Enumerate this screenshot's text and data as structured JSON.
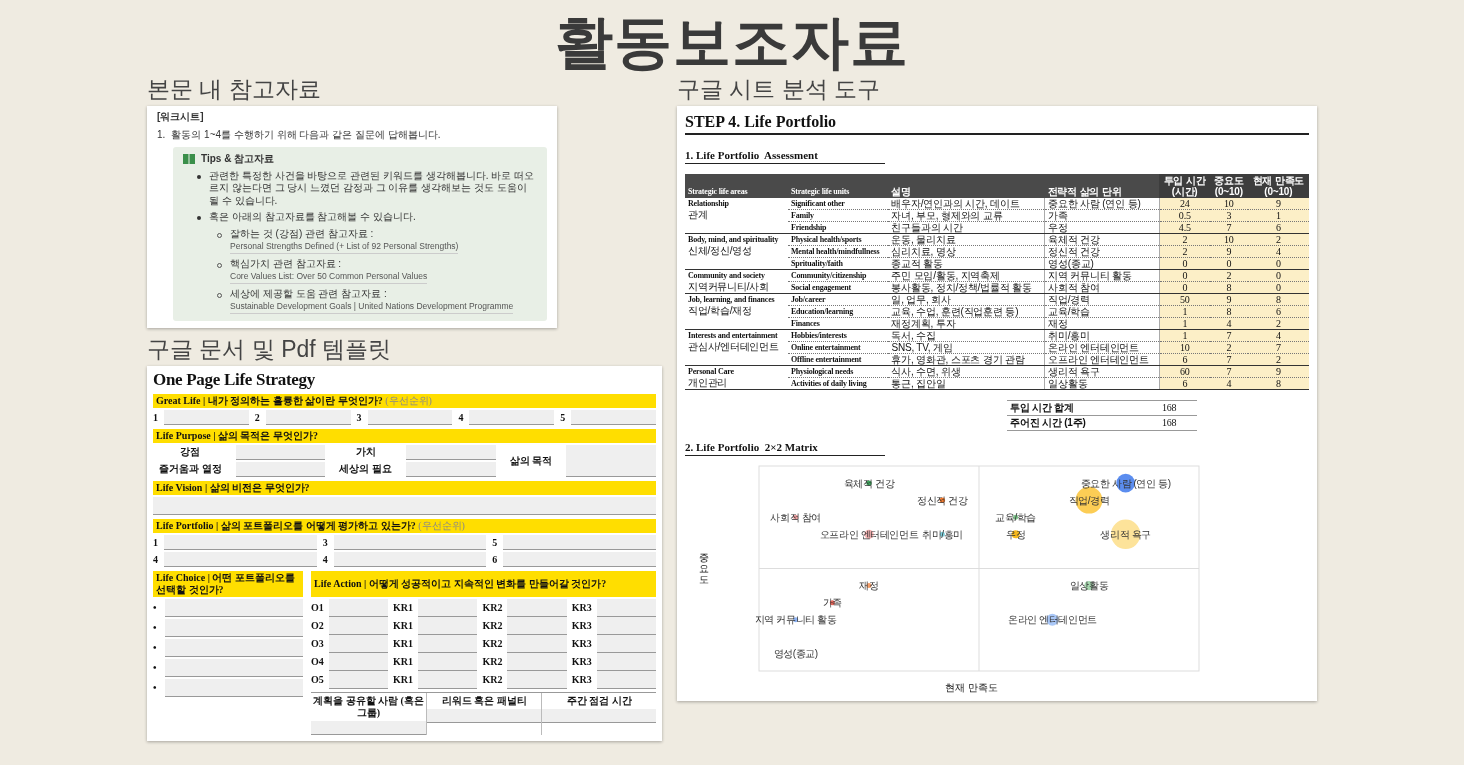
{
  "page_title": "활동보조자료",
  "reference": {
    "heading": "본문 내 참고자료",
    "tag": "[워크시트]",
    "item_number": "1.",
    "item_text": "활동의 1~4를 수행하기 위해 다음과 같은 질문에 답해봅니다.",
    "tips_title": "Tips & 참고자료",
    "bullets": [
      {
        "text": "관련한 특정한 사건을 바탕으로 관련된 키워드를 생각해봅니다. 바로 떠오르지 않는다면 그 당시 느꼈던 감정과 그 이유를 생각해보는 것도 도움이 될 수 있습니다."
      },
      {
        "text": "혹은 아래의 참고자료를 참고해볼 수 있습니다.",
        "links": [
          {
            "label": "잘하는 것 (강점) 관련 참고자료 :",
            "link": "Personal Strengths Defined (+ List of 92 Personal Strengths)"
          },
          {
            "label": "핵심가치 관련 참고자료 :",
            "link": "Core Values List: Over 50 Common Personal Values"
          },
          {
            "label": "세상에 제공할 도움 관련 참고자료 :",
            "link": "Sustainable Development Goals | United Nations Development Programme"
          }
        ]
      }
    ]
  },
  "doc": {
    "heading": "구글 문서 및 Pdf 템플릿",
    "title": "One Page Life Strategy",
    "great_life": {
      "label": "Great Life | 내가 정의하는 훌륭한 삶이란 무엇인가?",
      "note": "(우선순위)",
      "fields": [
        "1",
        "2",
        "3",
        "4",
        "5"
      ]
    },
    "life_purpose": {
      "label": "Life Purpose | 삶의 목적은 무엇인가?",
      "fields": [
        "강점",
        "즐거움과 열정",
        "가치",
        "세상의 필요"
      ],
      "result": "삶의 목적"
    },
    "life_vision": {
      "label": "Life Vision | 삶의 비전은 무엇인가?"
    },
    "life_portfolio": {
      "label": "Life Portfolio | 삶의 포트폴리오를 어떻게 평가하고 있는가?",
      "note": "(우선순위)",
      "fields": [
        "1",
        "3",
        "5",
        "4",
        "4",
        "6"
      ]
    },
    "life_choice": {
      "label": "Life Choice | 어떤 포트폴리오를 선택할 것인가?",
      "bullets": [
        "•",
        "•",
        "•",
        "•",
        "•"
      ]
    },
    "life_action": {
      "label": "Life Action | 어떻게 성공적이고 지속적인 변화를 만들어갈 것인가?",
      "rows": [
        {
          "objective": "O1",
          "results": [
            "KR1",
            "KR2",
            "KR3"
          ]
        },
        {
          "objective": "O2",
          "results": [
            "KR1",
            "KR2",
            "KR3"
          ]
        },
        {
          "objective": "O3",
          "results": [
            "KR1",
            "KR2",
            "KR3"
          ]
        },
        {
          "objective": "O4",
          "results": [
            "KR1",
            "KR2",
            "KR3"
          ]
        },
        {
          "objective": "O5",
          "results": [
            "KR1",
            "KR2",
            "KR3"
          ]
        }
      ]
    },
    "commitment": [
      "계획을 공유할 사람 (혹은 그룹)",
      "리워드 혹은 패널티",
      "주간 점검 시간"
    ]
  },
  "sheet": {
    "heading": "구글 시트 분석 도구",
    "title": "STEP 4. Life Portfolio",
    "assessment_title": "1. Life Portfolio  Assessment",
    "columns": [
      "Strategic life areas",
      "Strategic life units",
      "설명",
      "전략적 삶의 단위",
      "투입 시간\n(시간)",
      "중요도\n(0~10)",
      "현재 만족도\n(0~10)"
    ],
    "groups": [
      {
        "area": "Relationship",
        "area_ko": "관계",
        "units": [
          {
            "unit": "Significant other",
            "desc": "배우자/연인과의 시간, 데이트",
            "strategic": "중요한 사람 (연인 등)",
            "hours": "24",
            "importance": "10",
            "satisfaction": "9",
            "bubble": {
              "label": "중요한 사람 (연인 등)",
              "color": "#5b8def"
            }
          },
          {
            "unit": "Family",
            "desc": "자녀, 부모, 형제와의 교류",
            "strategic": "가족",
            "hours": "0.5",
            "importance": "3",
            "satisfaction": "1",
            "bubble": {
              "label": "가족",
              "color": "#e8665a"
            }
          },
          {
            "unit": "Friendship",
            "desc": "친구들과의 시간",
            "strategic": "우정",
            "hours": "4.5",
            "importance": "7",
            "satisfaction": "6",
            "bubble": {
              "label": "우정",
              "color": "#f6b81c"
            }
          }
        ]
      },
      {
        "area": "Body, mind, and spirituality",
        "area_ko": "신체/정신/영성",
        "units": [
          {
            "unit": "Physical health/sports",
            "desc": "운동, 물리치료",
            "strategic": "육체적 건강",
            "hours": "2",
            "importance": "10",
            "satisfaction": "2",
            "bubble": {
              "label": "육체적 건강",
              "color": "#3aa55a"
            }
          },
          {
            "unit": "Mental health/mindfullness",
            "desc": "심리치료, 명상",
            "strategic": "정신적 건강",
            "hours": "2",
            "importance": "9",
            "satisfaction": "4",
            "bubble": {
              "label": "정신적 건강",
              "color": "#f47a2c"
            }
          },
          {
            "unit": "Sprituality/faith",
            "desc": "종교적 활동",
            "strategic": "영성(종교)",
            "hours": "0",
            "importance": "0",
            "satisfaction": "0",
            "bubble": {
              "label": "영성(종교)"
            }
          }
        ]
      },
      {
        "area": "Community and society",
        "area_ko": "지역커뮤니티/사회",
        "units": [
          {
            "unit": "Community/citizenship",
            "desc": "주민 모임/활동, 지역축제",
            "strategic": "지역 커뮤니티 활동",
            "hours": "0",
            "importance": "2",
            "satisfaction": "0",
            "bubble": {
              "label": "지역 커뮤니티 활동",
              "color": "#8fb4f5"
            }
          },
          {
            "unit": "Social engagement",
            "desc": "봉사활동, 정치/정책/법률적 활동",
            "strategic": "사회적 참여",
            "hours": "0",
            "importance": "8",
            "satisfaction": "0",
            "bubble": {
              "label": "사회적 참여",
              "color": "#f2a3a3"
            }
          }
        ]
      },
      {
        "area": "Job, learning, and finances",
        "area_ko": "직업/학습/재정",
        "units": [
          {
            "unit": "Job/career",
            "desc": "일, 업무, 회사",
            "strategic": "직업/경력",
            "hours": "50",
            "importance": "9",
            "satisfaction": "8",
            "bubble": {
              "label": "직업/경력",
              "color": "#fccd55"
            }
          },
          {
            "unit": "Education/learning",
            "desc": "교육, 수업, 훈련(직업훈련 등)",
            "strategic": "교육/학습",
            "hours": "1",
            "importance": "8",
            "satisfaction": "6",
            "bubble": {
              "label": "교육/학습",
              "color": "#7cc68a"
            }
          },
          {
            "unit": "Finances",
            "desc": "재정계획, 투자",
            "strategic": "재정",
            "hours": "1",
            "importance": "4",
            "satisfaction": "2",
            "bubble": {
              "label": "재정",
              "color": "#f7a06b"
            }
          }
        ]
      },
      {
        "area": "Interests and entertainment",
        "area_ko": "관심사/엔터테인먼트",
        "units": [
          {
            "unit": "Hobbies/interests",
            "desc": "독서, 수집",
            "strategic": "취미/흥미",
            "hours": "1",
            "importance": "7",
            "satisfaction": "4",
            "bubble": {
              "label": "취미/흥미",
              "color": "#7fd3e0"
            }
          },
          {
            "unit": "Online entertainment",
            "desc": "SNS, TV, 게임",
            "strategic": "온라인 엔터테인먼트",
            "hours": "10",
            "importance": "2",
            "satisfaction": "7",
            "bubble": {
              "label": "온라인 엔터테인먼트",
              "color": "#a9c7f7"
            }
          },
          {
            "unit": "Offline entertainment",
            "desc": "휴가, 영화관, 스포츠 경기 관람",
            "strategic": "오프라인 엔터테인먼트",
            "hours": "6",
            "importance": "7",
            "satisfaction": "2",
            "bubble": {
              "label": "오프라인 엔터테인먼트",
              "color": "#f6b3b3"
            }
          }
        ]
      },
      {
        "area": "Personal Care",
        "area_ko": "개인관리",
        "units": [
          {
            "unit": "Physiological needs",
            "desc": "식사, 수면, 위생",
            "strategic": "생리적 욕구",
            "hours": "60",
            "importance": "7",
            "satisfaction": "9",
            "bubble": {
              "label": "생리적 욕구",
              "color": "#fde39a"
            }
          },
          {
            "unit": "Activities of daily living",
            "desc": "통근, 집안일",
            "strategic": "일상활동",
            "hours": "6",
            "importance": "4",
            "satisfaction": "8",
            "bubble": {
              "label": "일상활동",
              "color": "#a8d8b0"
            }
          }
        ]
      }
    ],
    "summary": [
      {
        "label": "투입 시간 합계",
        "value": "168"
      },
      {
        "label": "주어진 시간 (1주)",
        "value": "168"
      }
    ],
    "matrix": {
      "title": "2. Life Portfolio  2×2 Matrix",
      "y_label": "중요도",
      "x_label": "현재 만족도"
    }
  }
}
